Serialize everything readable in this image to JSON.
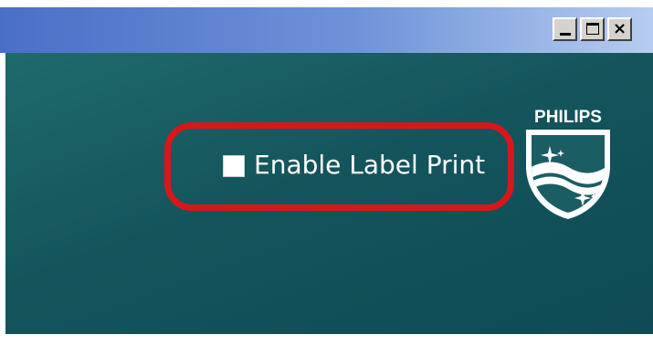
{
  "window": {
    "controls": {
      "minimize": "_",
      "maximize": "□",
      "close": "×"
    }
  },
  "options": {
    "enable_label_print": {
      "label": "Enable Label Print",
      "checked": false
    }
  },
  "branding": {
    "logo_text": "PHILIPS"
  },
  "colors": {
    "background": "#14555c",
    "highlight": "#d6171c",
    "titlebar": "#6f93d9"
  }
}
